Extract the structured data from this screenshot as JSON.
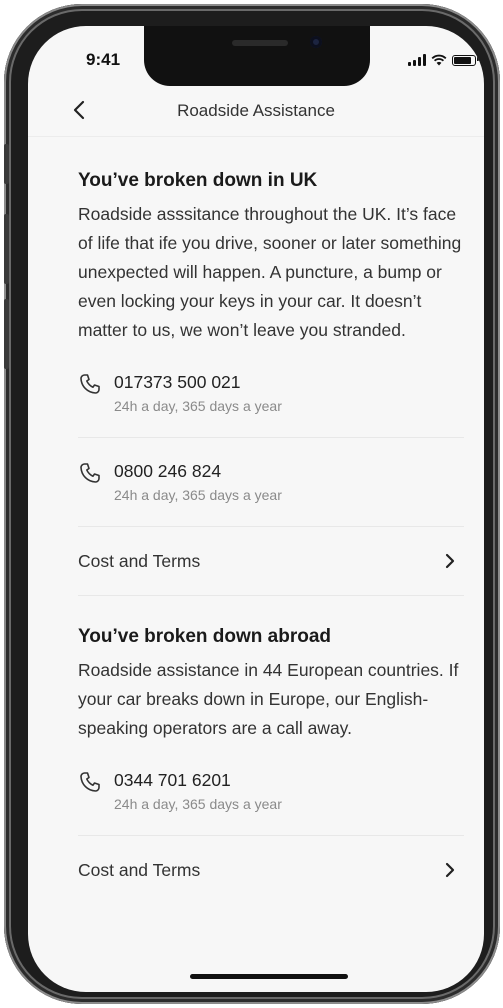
{
  "status_bar": {
    "time": "9:41"
  },
  "nav": {
    "title": "Roadside Assistance"
  },
  "uk": {
    "heading": "You’ve broken down in UK",
    "body": "Roadside asssitance throughout the UK. It’s face of life that ife you drive, sooner or later something unexpected will happen. A puncture, a bump or even locking your keys in your car. It doesn’t matter to us, we won’t leave you stranded.",
    "phones": [
      {
        "number": "017373 500 021",
        "hours": "24h a day, 365 days a year"
      },
      {
        "number": "0800 246 824",
        "hours": "24h a day, 365 days a year"
      }
    ],
    "terms_label": "Cost and Terms"
  },
  "abroad": {
    "heading": "You’ve broken down abroad",
    "body": "Roadside assistance in 44 European countries. If your car breaks down in Europe, our English-speaking operators are a call away.",
    "phones": [
      {
        "number": "0344 701 6201",
        "hours": "24h a day, 365 days a year"
      }
    ],
    "terms_label": "Cost and Terms"
  },
  "icons": {
    "back": "chevron-left-icon",
    "phone": "phone-icon",
    "forward": "chevron-right-icon"
  },
  "colors": {
    "screen_bg": "#f7f7f7",
    "text": "#1f1f1f",
    "muted": "#8a8a8a",
    "divider": "#e8e8e8"
  }
}
